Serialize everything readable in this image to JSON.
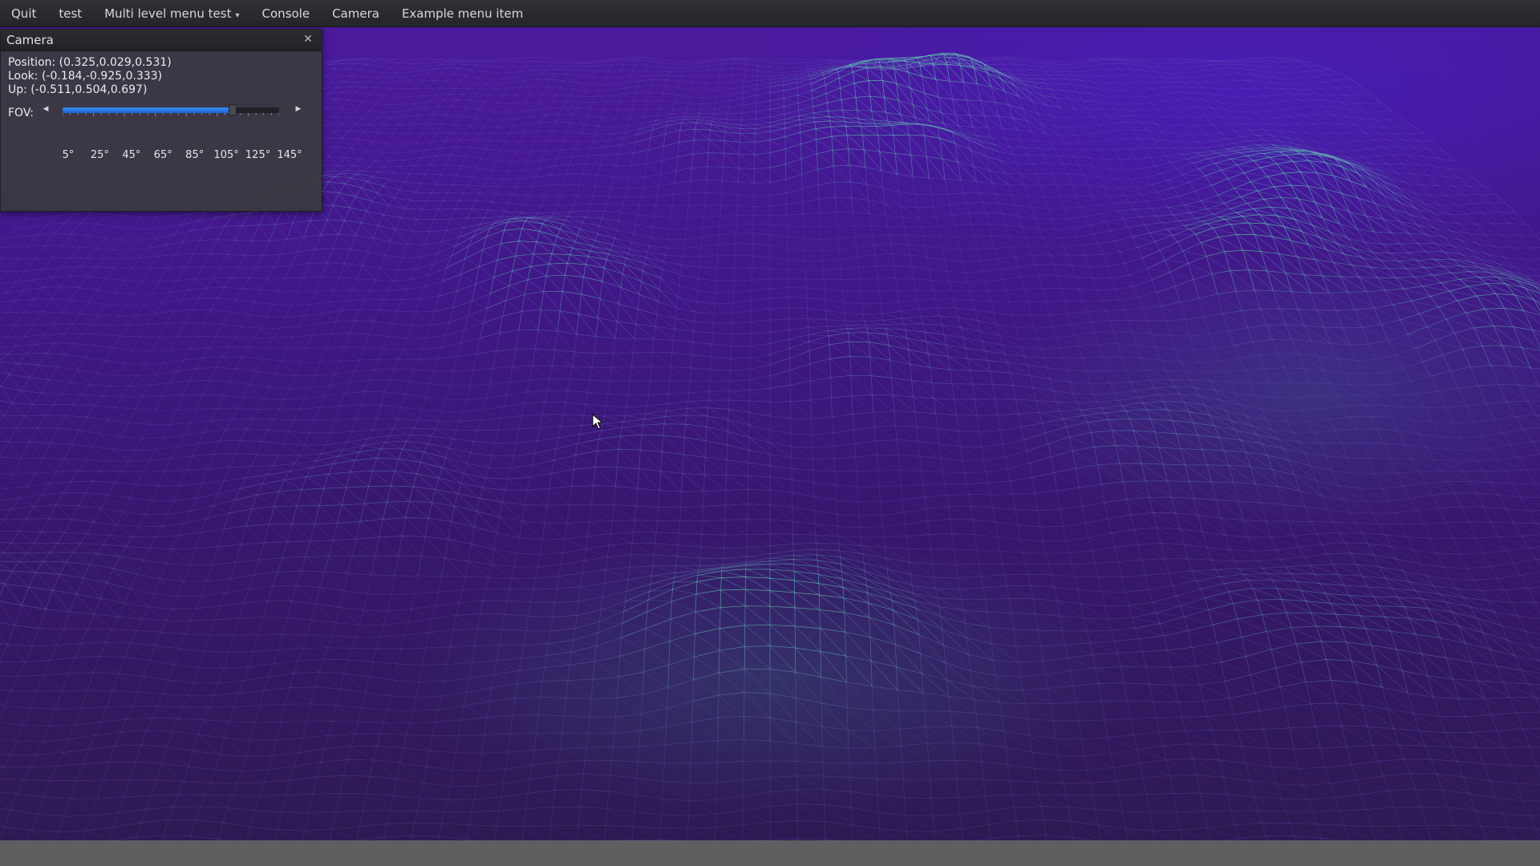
{
  "menubar": {
    "items": [
      {
        "label": "Quit"
      },
      {
        "label": "test"
      },
      {
        "label": "Multi level menu test",
        "has_dropdown": true
      },
      {
        "label": "Console"
      },
      {
        "label": "Camera"
      },
      {
        "label": "Example menu item"
      }
    ],
    "dropdown_arrow": "▾"
  },
  "camera_panel": {
    "title": "Camera",
    "close_glyph": "✕",
    "position_text": "Position: (0.325,0.029,0.531)",
    "look_text": "Look: (-0.184,-0.925,0.333)",
    "up_text": "Up: (-0.511,0.504,0.697)",
    "fov": {
      "label": "FOV:",
      "min_degrees": 5,
      "max_degrees": 145,
      "value_degrees": 115,
      "tick_labels": [
        "5°",
        "25°",
        "45°",
        "65°",
        "85°",
        "105°",
        "125°",
        "145°"
      ],
      "left_arrow": "◀",
      "right_arrow": "▶"
    }
  },
  "viewport": {
    "render_mode": "wireframe terrain",
    "colors": {
      "background_top": "#4a1a9c",
      "background_bottom": "#2d1a52",
      "wire_low": "#6a4fc0",
      "wire_high": "#5fd0b0"
    }
  },
  "icons": {
    "close": "close-icon",
    "dropdown": "chevron-down-icon",
    "slider_left": "arrow-left-icon",
    "slider_right": "arrow-right-icon",
    "cursor": "mouse-pointer-icon"
  }
}
